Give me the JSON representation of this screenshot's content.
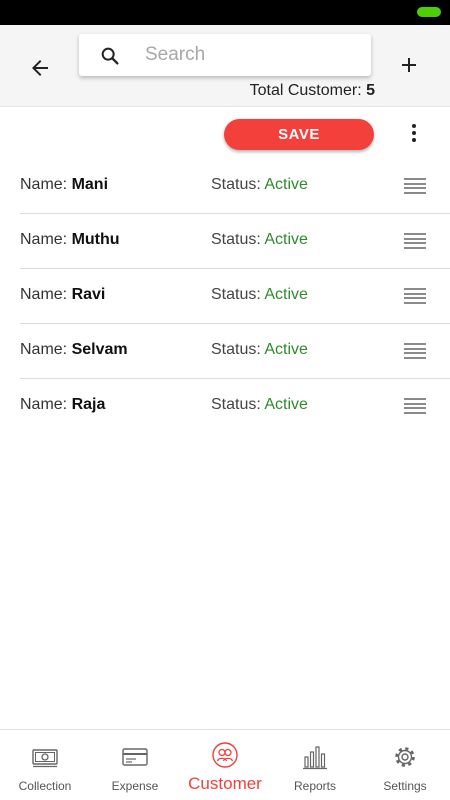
{
  "header": {
    "search_placeholder": "Search",
    "total_label": "Total Customer:",
    "total_count": "5"
  },
  "toolbar": {
    "save_label": "SAVE"
  },
  "customers": [
    {
      "name_label": "Name:",
      "name": "Mani",
      "status_label": "Status:",
      "status": "Active"
    },
    {
      "name_label": "Name:",
      "name": "Muthu",
      "status_label": "Status:",
      "status": "Active"
    },
    {
      "name_label": "Name:",
      "name": "Ravi",
      "status_label": "Status:",
      "status": "Active"
    },
    {
      "name_label": "Name:",
      "name": "Selvam",
      "status_label": "Status:",
      "status": "Active"
    },
    {
      "name_label": "Name:",
      "name": "Raja",
      "status_label": "Status:",
      "status": "Active"
    }
  ],
  "nav": {
    "items": [
      {
        "label": "Collection",
        "icon": "cash-icon"
      },
      {
        "label": "Expense",
        "icon": "card-icon"
      },
      {
        "label": "Customer",
        "icon": "customers-icon"
      },
      {
        "label": "Reports",
        "icon": "bar-chart-icon"
      },
      {
        "label": "Settings",
        "icon": "gear-icon"
      }
    ],
    "active": "Customer"
  },
  "colors": {
    "accent": "#f4403a",
    "active_status": "#2e8b2e",
    "battery": "#4cd100"
  }
}
